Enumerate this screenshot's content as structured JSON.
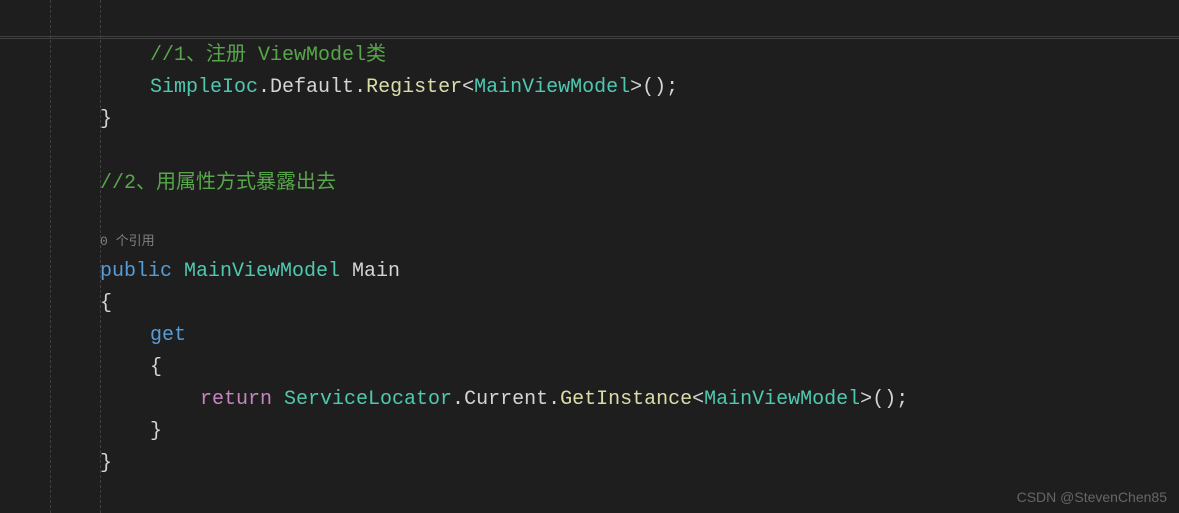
{
  "code": {
    "comment1": "//1、注册 ViewModel类",
    "line2_type1": "SimpleIoc",
    "line2_dot1": ".",
    "line2_prop1": "Default",
    "line2_dot2": ".",
    "line2_method": "Register",
    "line2_lt": "<",
    "line2_generic": "MainViewModel",
    "line2_gt": ">",
    "line2_parens": "();",
    "line3_brace": "}",
    "comment2": "//2、用属性方式暴露出去",
    "codelens": "0 个引用",
    "line_public": "public",
    "line_proptype": " MainViewModel ",
    "line_propname": "Main",
    "line_openbrace": "{",
    "line_get": "get",
    "line_openbrace2": "{",
    "line_return": "return",
    "line_sl": " ServiceLocator",
    "line_dot3": ".",
    "line_current": "Current",
    "line_dot4": ".",
    "line_getinst": "GetInstance",
    "line_lt2": "<",
    "line_generic2": "MainViewModel",
    "line_gt2": ">",
    "line_parens2": "();",
    "line_closebrace2": "}",
    "line_closebrace": "}"
  },
  "watermark": "CSDN @StevenChen85"
}
